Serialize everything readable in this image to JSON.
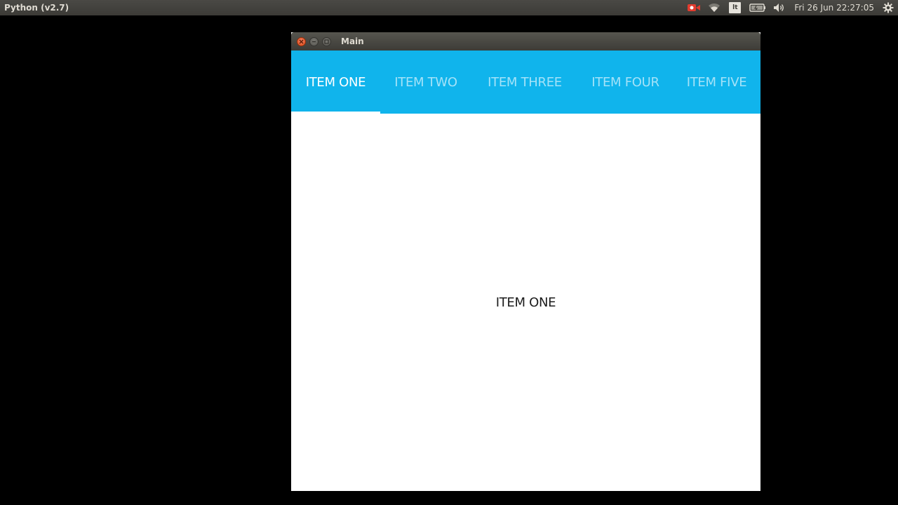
{
  "panel": {
    "app_name": "Python (v2.7)",
    "keyboard_layout": "lt",
    "clock": "Fri 26 Jun 22:27:05",
    "indicators": [
      "record-icon",
      "wifi-icon",
      "keyboard-layout-indicator",
      "battery-icon",
      "volume-icon",
      "gear-icon"
    ]
  },
  "window": {
    "title": "Main"
  },
  "tabs": [
    {
      "label": "ITEM ONE",
      "active": true
    },
    {
      "label": "ITEM TWO",
      "active": false
    },
    {
      "label": "ITEM THREE",
      "active": false
    },
    {
      "label": "ITEM FOUR",
      "active": false
    },
    {
      "label": "ITEM FIVE",
      "active": false
    }
  ],
  "content": {
    "label": "ITEM ONE"
  },
  "colors": {
    "tab_bar": "#10b4ec",
    "tab_active_text": "#ffffff",
    "tab_inactive_text": "#a5e3f8",
    "indicator": "#ffffff",
    "content_bg": "#ffffff"
  }
}
